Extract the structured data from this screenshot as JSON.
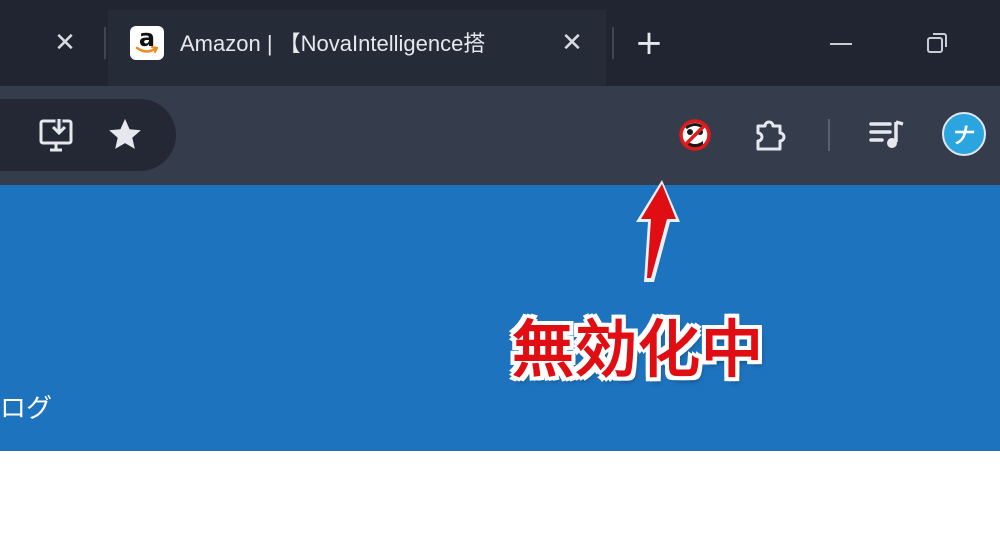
{
  "tabs": [
    {
      "title": "",
      "close_symbol": "✕"
    },
    {
      "title": "Amazon | 【NovaIntelligence搭",
      "close_symbol": "✕",
      "favicon_letter": "a"
    }
  ],
  "tab_strip": {
    "new_tab_symbol": "+"
  },
  "toolbar": {
    "icons": [
      "install-app-icon",
      "bookmark-star-icon",
      "disabled-extension-icon",
      "extensions-puzzle-icon",
      "reading-list-icon"
    ],
    "profile_initial": "ナ"
  },
  "page": {
    "banner_text": "ログ",
    "banner_color": "#1e73be"
  },
  "annotation": {
    "label": "無効化中",
    "color": "#e00d12"
  },
  "colors": {
    "tabstrip": "#202531",
    "toolbar": "#353c4b",
    "omnibox": "#232834"
  }
}
